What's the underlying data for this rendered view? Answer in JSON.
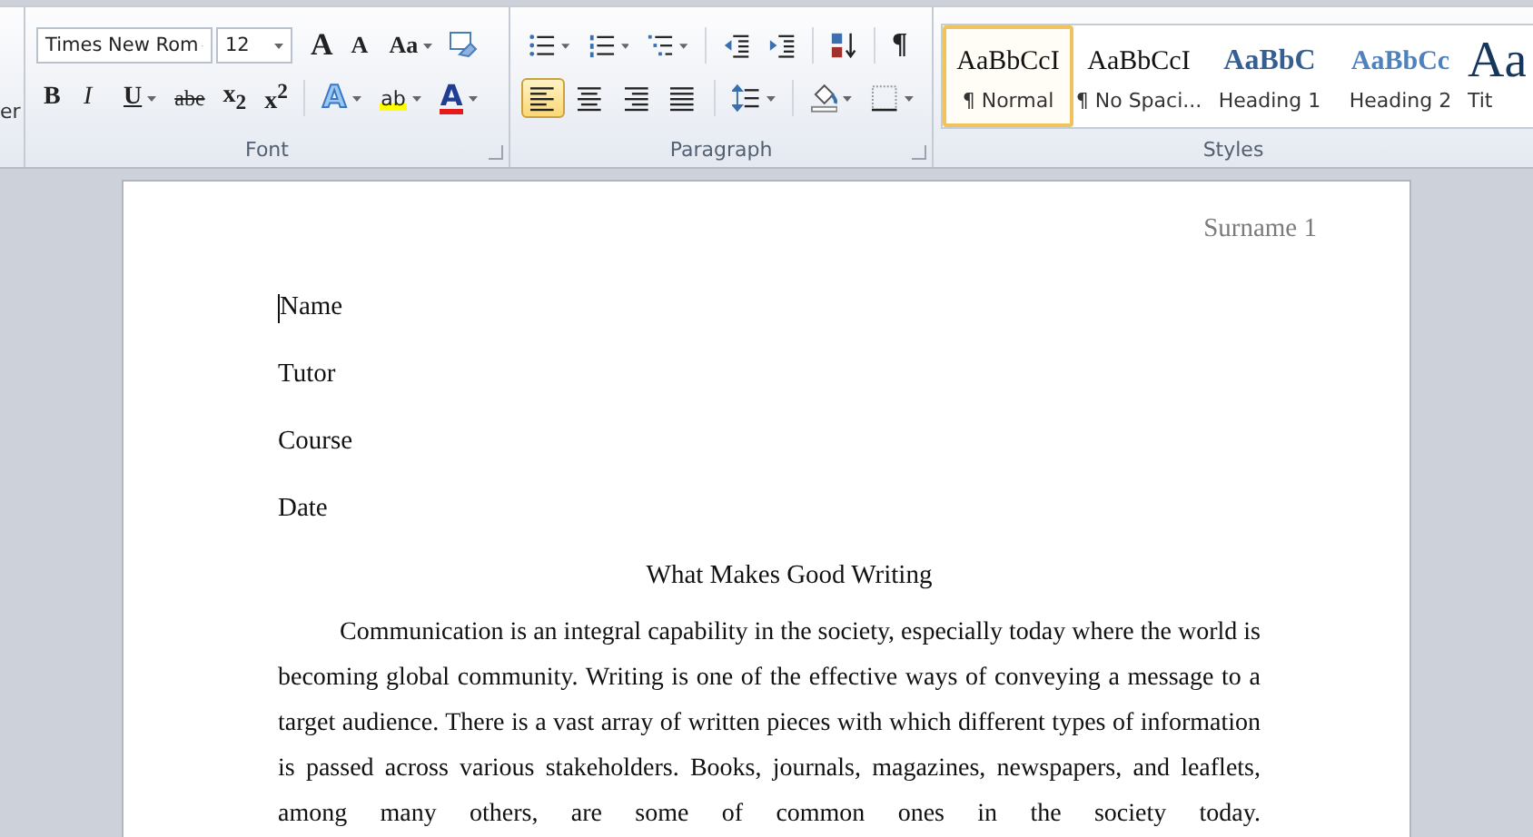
{
  "ribbon": {
    "clipped_group": {
      "text": "er"
    },
    "font_group": {
      "label": "Font",
      "font_name": "Times New Rom",
      "font_size": "12",
      "row1": [
        {
          "kind": "grow",
          "glyph": "A",
          "selected": false,
          "dropdown": false
        },
        {
          "kind": "shrink",
          "glyph": "A",
          "selected": false,
          "dropdown": false
        },
        {
          "kind": "case",
          "glyph": "Aa",
          "selected": false,
          "dropdown": true
        },
        {
          "kind": "clear",
          "selected": false,
          "dropdown": false
        }
      ],
      "row2": [
        {
          "kind": "bold",
          "glyph": "B",
          "selected": false,
          "dropdown": false
        },
        {
          "kind": "italic",
          "glyph": "I",
          "selected": false,
          "dropdown": false
        },
        {
          "kind": "underline",
          "glyph": "U",
          "selected": false,
          "dropdown": true
        },
        {
          "kind": "strike",
          "glyph": "abe",
          "selected": false,
          "dropdown": false
        },
        {
          "kind": "subscript",
          "glyph": "x$_{2}$",
          "selected": false,
          "dropdown": false
        },
        {
          "kind": "superscript",
          "glyph": "x$^{2}$",
          "selected": false,
          "dropdown": false
        },
        {
          "kind": "sep"
        },
        {
          "kind": "effects",
          "glyph": "A",
          "selected": false,
          "dropdown": true
        },
        {
          "kind": "highlight",
          "glyph": "ab",
          "selected": false,
          "dropdown": true
        },
        {
          "kind": "color",
          "glyph": "A",
          "selected": false,
          "dropdown": true
        }
      ]
    },
    "paragraph_group": {
      "label": "Paragraph",
      "row1": [
        {
          "kind": "bullets",
          "selected": false,
          "dropdown": true
        },
        {
          "kind": "numbering",
          "selected": false,
          "dropdown": true
        },
        {
          "kind": "multilevel",
          "selected": false,
          "dropdown": true
        },
        {
          "kind": "sep"
        },
        {
          "kind": "decrease_indent",
          "selected": false,
          "dropdown": false
        },
        {
          "kind": "increase_indent",
          "selected": false,
          "dropdown": false
        },
        {
          "kind": "sep"
        },
        {
          "kind": "sort",
          "selected": false,
          "dropdown": false
        },
        {
          "kind": "sep"
        },
        {
          "kind": "pilcrow",
          "glyph": "¶",
          "selected": false,
          "dropdown": false
        }
      ],
      "row2": [
        {
          "kind": "align_left",
          "selected": true,
          "dropdown": false
        },
        {
          "kind": "align_center",
          "selected": false,
          "dropdown": false
        },
        {
          "kind": "align_right",
          "selected": false,
          "dropdown": false
        },
        {
          "kind": "justify",
          "selected": false,
          "dropdown": false
        },
        {
          "kind": "sep"
        },
        {
          "kind": "line_spacing",
          "selected": false,
          "dropdown": true
        },
        {
          "kind": "sep"
        },
        {
          "kind": "shading",
          "selected": false,
          "dropdown": true
        },
        {
          "kind": "borders",
          "selected": false,
          "dropdown": true
        }
      ]
    },
    "styles_group": {
      "label": "Styles",
      "items": [
        {
          "kind": "normal",
          "preview": "AaBbCcI",
          "label": "¶ Normal",
          "selected": true
        },
        {
          "kind": "normal",
          "preview": "AaBbCcI",
          "label": "¶ No Spaci...",
          "selected": false
        },
        {
          "kind": "heading1",
          "preview": "AaBbC",
          "label": "Heading 1",
          "selected": false
        },
        {
          "kind": "heading2",
          "preview": "AaBbCc",
          "label": "Heading 2",
          "selected": false
        },
        {
          "kind": "title",
          "preview": "Aa",
          "label": "Tit",
          "selected": false
        }
      ]
    }
  },
  "document": {
    "header": "Surname 1",
    "lines": [
      "Name",
      "Tutor",
      "Course",
      "Date"
    ],
    "title": "What Makes Good Writing",
    "paragraphs": [
      "Communication is an integral capability in the society, especially today where the world is becoming global community. Writing is one of the effective ways of conveying a message to a target audience. There is a vast array of written pieces with which different types of information is passed across various stakeholders. Books, journals, magazines, newspapers, and leaflets, among many others, are some of common ones in the society today."
    ]
  }
}
